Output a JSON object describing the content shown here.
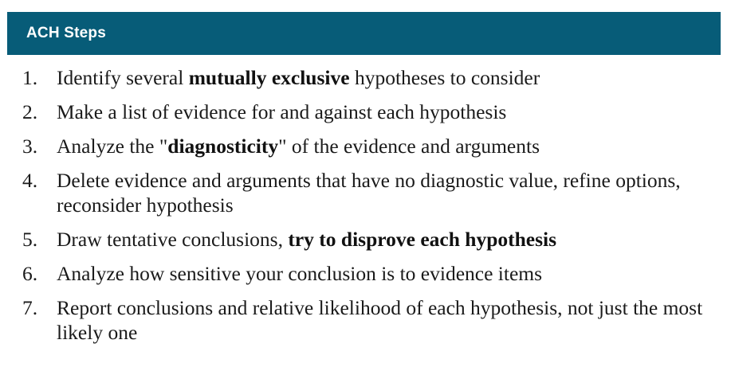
{
  "header": {
    "title": "ACH Steps"
  },
  "colors": {
    "header_background": "#075c78",
    "header_text": "#ffffff",
    "body_text": "#1a1a1a"
  },
  "steps": [
    {
      "number": "1.",
      "segments": [
        {
          "text": "Identify several ",
          "bold": false
        },
        {
          "text": "mutually exclusive",
          "bold": true
        },
        {
          "text": " hypotheses to consider",
          "bold": false
        }
      ]
    },
    {
      "number": "2.",
      "segments": [
        {
          "text": "Make a list of evidence for and against each hypothesis",
          "bold": false
        }
      ]
    },
    {
      "number": "3.",
      "segments": [
        {
          "text": "Analyze the \"",
          "bold": false
        },
        {
          "text": "diagnosticity",
          "bold": true
        },
        {
          "text": "\" of the evidence and arguments",
          "bold": false
        }
      ]
    },
    {
      "number": "4.",
      "segments": [
        {
          "text": "Delete evidence and arguments that have no diagnostic value, refine options, reconsider hypothesis",
          "bold": false
        }
      ]
    },
    {
      "number": "5.",
      "segments": [
        {
          "text": "Draw tentative conclusions, ",
          "bold": false
        },
        {
          "text": "try to disprove each hypothesis",
          "bold": true
        }
      ]
    },
    {
      "number": "6.",
      "segments": [
        {
          "text": "Analyze how sensitive your conclusion is to evidence items",
          "bold": false
        }
      ]
    },
    {
      "number": "7.",
      "segments": [
        {
          "text": "Report conclusions and relative likelihood of each hypothesis, not just the most likely one",
          "bold": false
        }
      ]
    }
  ]
}
